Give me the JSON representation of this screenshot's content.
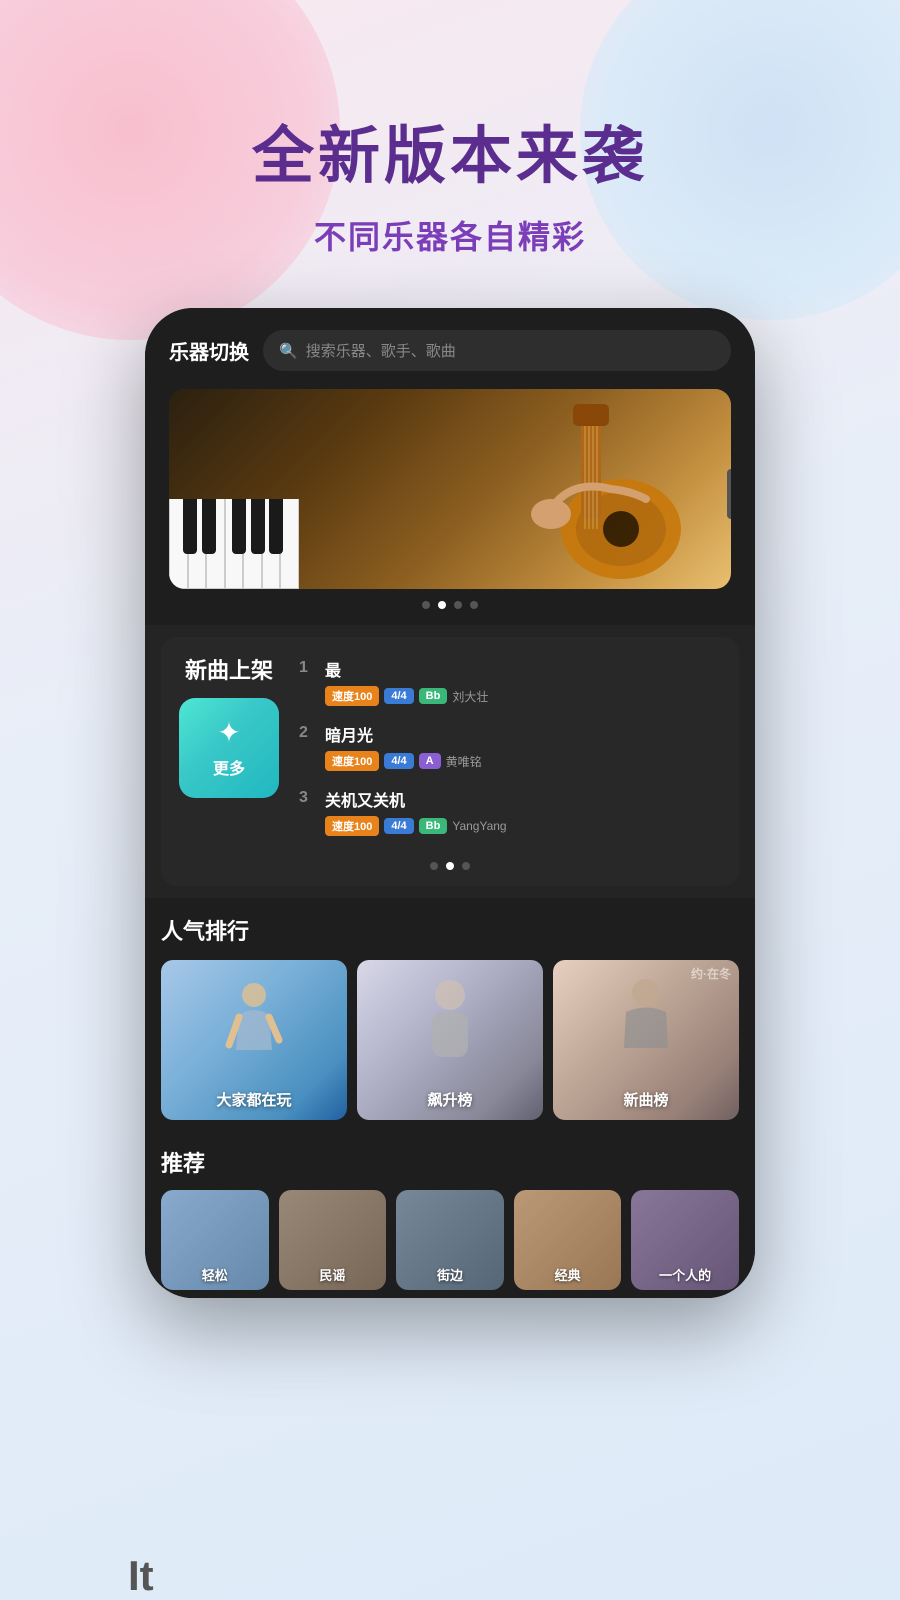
{
  "background": {
    "blob_pink": "pink blob",
    "blob_blue": "blue blob"
  },
  "hero": {
    "title": "全新版本来袭",
    "subtitle": "不同乐器各自精彩"
  },
  "phone": {
    "topbar": {
      "title": "乐器切换",
      "search_placeholder": "搜索乐器、歌手、歌曲"
    },
    "banner": {
      "dots": [
        {
          "active": false
        },
        {
          "active": true
        },
        {
          "active": false
        },
        {
          "active": false
        }
      ]
    },
    "new_songs": {
      "section_title": "新曲上架",
      "more_label": "更多",
      "songs": [
        {
          "num": "1",
          "name": "最",
          "tags": [
            "速度100",
            "4/4",
            "Bb"
          ],
          "tag_colors": [
            "orange",
            "blue",
            "green"
          ],
          "artist": "刘大壮"
        },
        {
          "num": "2",
          "name": "暗月光",
          "tags": [
            "速度100",
            "4/4",
            "A"
          ],
          "tag_colors": [
            "orange",
            "blue",
            "purple"
          ],
          "artist": "黄唯铭"
        },
        {
          "num": "3",
          "name": "关机又关机",
          "tags": [
            "速度100",
            "4/4",
            "Bb"
          ],
          "tag_colors": [
            "orange",
            "blue",
            "green"
          ],
          "artist": "YangYang"
        }
      ],
      "dots": [
        {
          "active": false
        },
        {
          "active": true
        },
        {
          "active": false
        }
      ]
    },
    "popular": {
      "title": "人气排行",
      "cards": [
        {
          "label": "大家都在玩",
          "bg": "1"
        },
        {
          "label": "飙升榜",
          "bg": "2"
        },
        {
          "label": "新曲榜",
          "bg": "3"
        }
      ]
    },
    "recommend": {
      "title": "推荐",
      "cards": [
        {
          "label": "轻松",
          "bg": "#8888aa"
        },
        {
          "label": "民谣",
          "bg": "#998877"
        },
        {
          "label": "街边",
          "bg": "#778899"
        },
        {
          "label": "经典",
          "bg": "#997766"
        },
        {
          "label": "一个人的",
          "bg": "#887799"
        }
      ]
    }
  },
  "bottom": {
    "text": "It"
  }
}
